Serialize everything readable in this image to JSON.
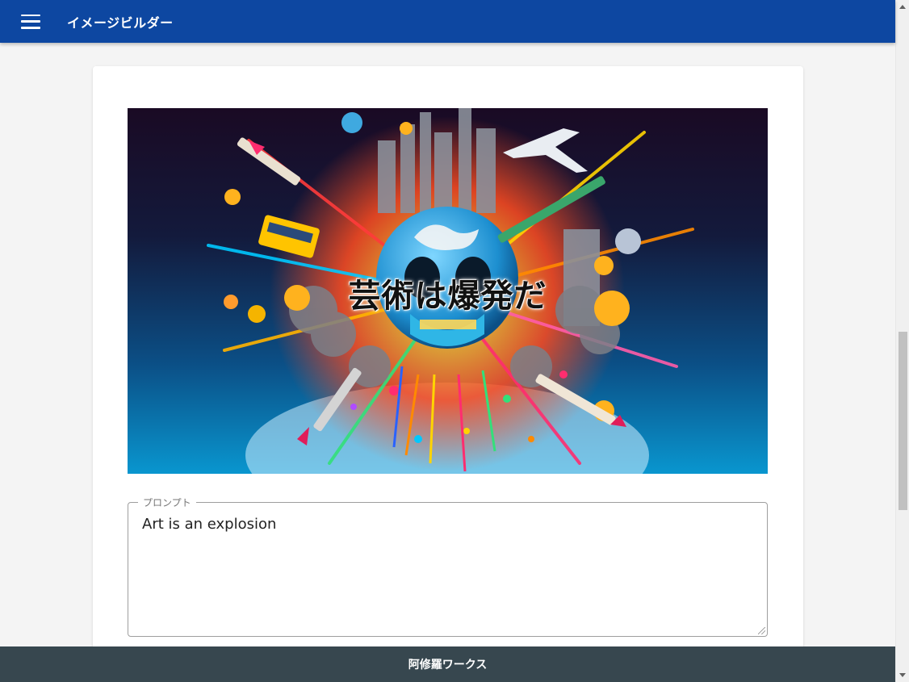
{
  "appbar": {
    "title": "イメージビルダー",
    "menu_icon": "hamburger-menu-icon",
    "color": "#0d47a1"
  },
  "hero": {
    "caption": "芸術は爆発だ"
  },
  "prompt": {
    "label": "プロンプト",
    "value": "Art is an explosion"
  },
  "footer": {
    "text": "阿修羅ワークス",
    "color": "#37474f"
  }
}
